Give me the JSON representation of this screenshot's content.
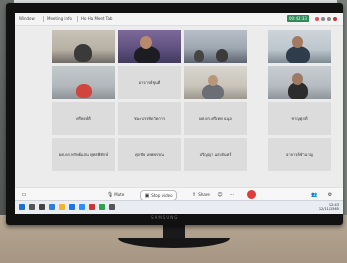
{
  "monitor": {
    "brand": "SAMSUNG"
  },
  "meeting_bar": {
    "menu_items": [
      "Window",
      "Meeting info",
      "Ho Ha Meet Tab"
    ],
    "status_badge": "00:42:33",
    "icons": [
      "shield-icon",
      "minimize-icon",
      "maximize-icon",
      "close-icon"
    ]
  },
  "gallery": {
    "video_tiles": [
      {
        "name": ""
      },
      {
        "name": ""
      },
      {
        "name": ""
      },
      {
        "name": ""
      },
      {
        "name": ""
      },
      {
        "name": ""
      },
      {
        "name": ""
      }
    ],
    "name_tiles": [
      {
        "name": "อาจารย์ชุนดี"
      },
      {
        "name": "ศรีพงษ์ดี"
      },
      {
        "name": "ชนะบรรทัดวัดการ"
      },
      {
        "name": "ผศ.ดร.ศรีเทพ ฉนุล"
      },
      {
        "name": "ชาญศุภดี"
      },
      {
        "name": "ผศ.ดร.ทรัพย์แสน พุทธพิทักษ์"
      },
      {
        "name": "ศุภชัย เทพพรรณ"
      },
      {
        "name": "ปริญญา แสงจันทร์"
      },
      {
        "name": "อาจารย์ชำนาญ"
      }
    ]
  },
  "toolbar": {
    "mute_label": "Mute",
    "stop_video_label": "Stop video",
    "share_label": "Share",
    "icons": [
      "chat-icon",
      "reactions-icon",
      "more-icon",
      "leave-icon",
      "people-icon",
      "settings-icon"
    ]
  },
  "taskbar": {
    "time": "12:43",
    "date": "12/11/2565"
  }
}
